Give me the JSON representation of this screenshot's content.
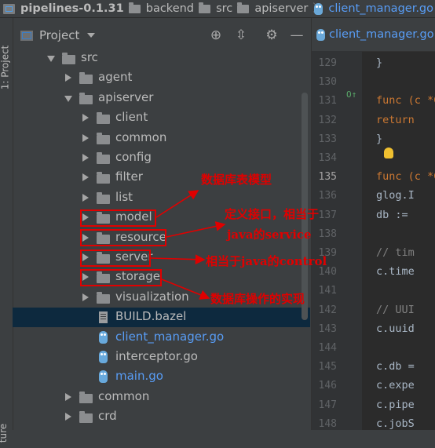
{
  "breadcrumb": [
    {
      "label": "pipelines-0.1.31",
      "icon": "project-icon"
    },
    {
      "label": "backend",
      "icon": "folder-icon"
    },
    {
      "label": "src",
      "icon": "folder-icon"
    },
    {
      "label": "apiserver",
      "icon": "folder-icon"
    },
    {
      "label": "client_manager.go",
      "icon": "go-file-icon"
    }
  ],
  "side_tabs": {
    "project": "1: Project",
    "structure": "ture"
  },
  "project_panel": {
    "title": "Project",
    "tree": [
      {
        "label": "src",
        "type": "folder",
        "expanded": true,
        "depth": 0
      },
      {
        "label": "agent",
        "type": "folder",
        "expanded": false,
        "depth": 1
      },
      {
        "label": "apiserver",
        "type": "folder",
        "expanded": true,
        "depth": 1
      },
      {
        "label": "client",
        "type": "folder",
        "expanded": false,
        "depth": 2
      },
      {
        "label": "common",
        "type": "folder",
        "expanded": false,
        "depth": 2
      },
      {
        "label": "config",
        "type": "folder",
        "expanded": false,
        "depth": 2
      },
      {
        "label": "filter",
        "type": "folder",
        "expanded": false,
        "depth": 2
      },
      {
        "label": "list",
        "type": "folder",
        "expanded": false,
        "depth": 2
      },
      {
        "label": "model",
        "type": "folder",
        "expanded": false,
        "depth": 2
      },
      {
        "label": "resource",
        "type": "folder",
        "expanded": false,
        "depth": 2
      },
      {
        "label": "server",
        "type": "folder",
        "expanded": false,
        "depth": 2
      },
      {
        "label": "storage",
        "type": "folder",
        "expanded": false,
        "depth": 2
      },
      {
        "label": "visualization",
        "type": "folder",
        "expanded": false,
        "depth": 2
      },
      {
        "label": "BUILD.bazel",
        "type": "bazel",
        "depth": 2,
        "selected": true
      },
      {
        "label": "client_manager.go",
        "type": "go",
        "depth": 2,
        "open": true
      },
      {
        "label": "interceptor.go",
        "type": "go",
        "depth": 2
      },
      {
        "label": "main.go",
        "type": "go",
        "depth": 2,
        "open": true
      },
      {
        "label": "common",
        "type": "folder",
        "expanded": false,
        "depth": 1
      },
      {
        "label": "crd",
        "type": "folder",
        "expanded": false,
        "depth": 1
      }
    ]
  },
  "annotations": {
    "model": "数据库表模型",
    "resource_line1": "定义接口，相当于",
    "resource_line2": "java的service",
    "server": "相当于java的control",
    "storage": "数据库操作的实现"
  },
  "editor": {
    "tab_label": "client_manager.go",
    "lines": [
      {
        "n": "129",
        "code": "}"
      },
      {
        "n": "130",
        "code": ""
      },
      {
        "n": "131",
        "code": "func (c *C"
      },
      {
        "n": "132",
        "code": "    return"
      },
      {
        "n": "133",
        "code": "}"
      },
      {
        "n": "134",
        "code": ""
      },
      {
        "n": "135",
        "code": "func (c *C"
      },
      {
        "n": "136",
        "code": "    glog.I"
      },
      {
        "n": "137",
        "code": "    db :="
      },
      {
        "n": "138",
        "code": ""
      },
      {
        "n": "139",
        "code": "    // tim"
      },
      {
        "n": "140",
        "code": "    c.time"
      },
      {
        "n": "141",
        "code": ""
      },
      {
        "n": "142",
        "code": "    // UUI"
      },
      {
        "n": "143",
        "code": "    c.uuid"
      },
      {
        "n": "144",
        "code": ""
      },
      {
        "n": "145",
        "code": "    c.db ="
      },
      {
        "n": "146",
        "code": "    c.expe"
      },
      {
        "n": "147",
        "code": "    c.pipe"
      },
      {
        "n": "148",
        "code": "    c.jobS"
      }
    ],
    "current_line": "135",
    "gutter_marker": "O↑"
  },
  "colors": {
    "annotation": "#e00000",
    "link_blue": "#589df6",
    "keyword": "#cc7832",
    "selection": "#0d293e"
  }
}
